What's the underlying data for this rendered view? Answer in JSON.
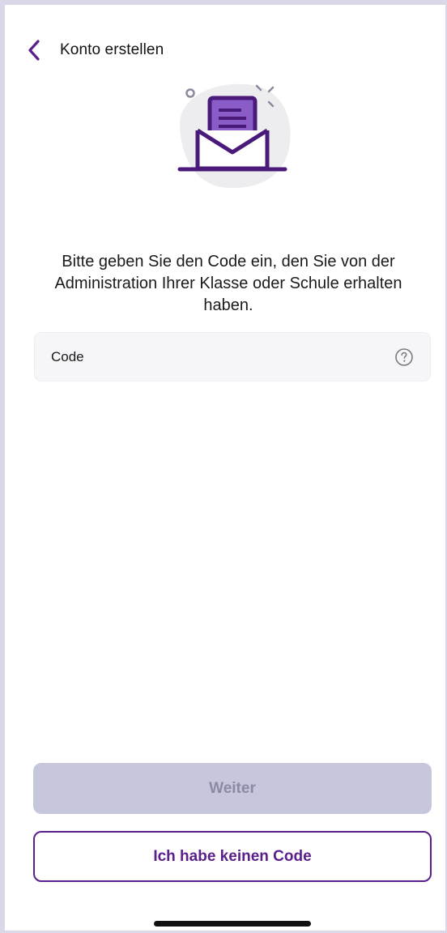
{
  "header": {
    "title": "Konto erstellen"
  },
  "instruction": {
    "text": "Bitte geben Sie den Code ein, den Sie von der Administration Ihrer Klasse oder Schule erhalten haben."
  },
  "code_field": {
    "label": "Code"
  },
  "buttons": {
    "continue_label": "Weiter",
    "no_code_label": "Ich habe keinen Code"
  },
  "colors": {
    "accent": "#5a1f8a",
    "accent_light": "#8a5cc8",
    "disabled_button_bg": "#c6c6dc",
    "disabled_button_text": "#8a8aa6",
    "field_bg": "#f6f6f8"
  },
  "icons": {
    "back": "chevron-left-icon",
    "help": "question-circle-icon",
    "illustration": "open-envelope-letter-icon"
  }
}
